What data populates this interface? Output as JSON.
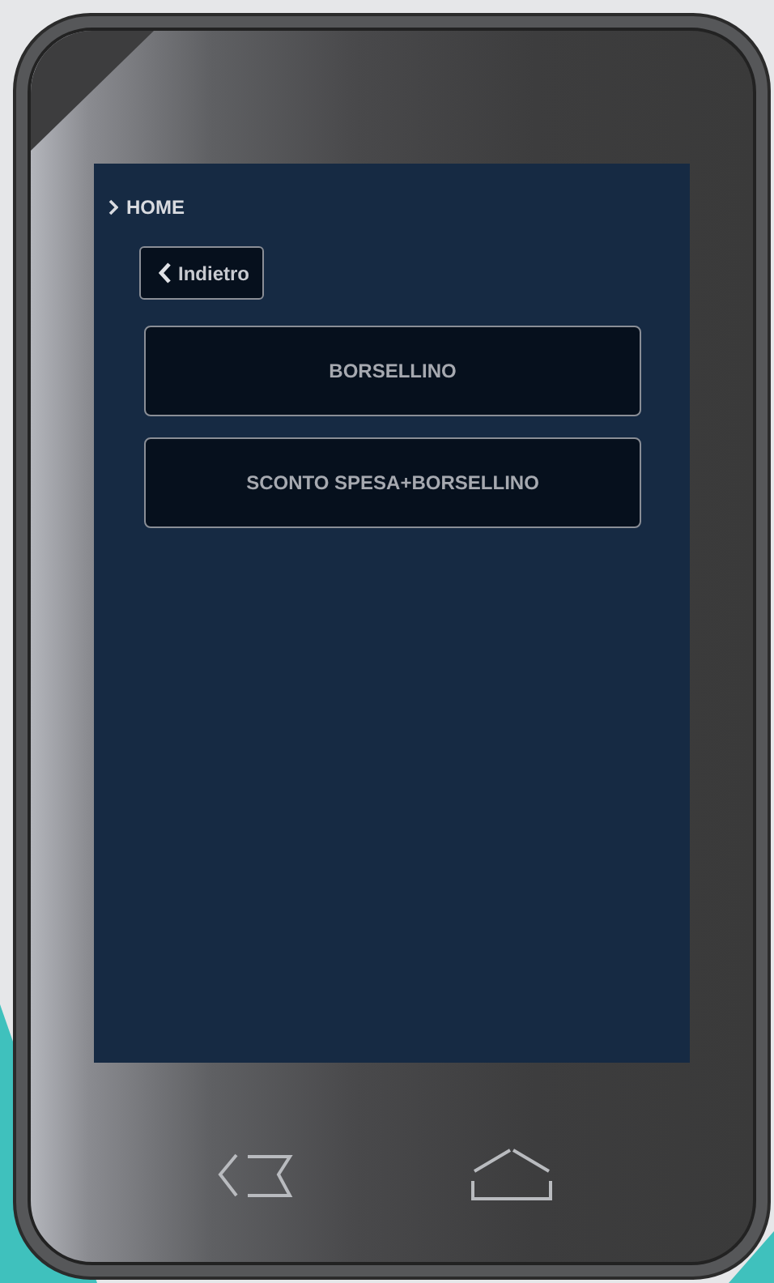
{
  "breadcrumb": {
    "label": "HOME"
  },
  "back_button": {
    "label": "Indietro"
  },
  "menu_buttons": [
    {
      "label": "BORSELLINO"
    },
    {
      "label": "SCONTO SPESA+BORSELLINO"
    }
  ]
}
